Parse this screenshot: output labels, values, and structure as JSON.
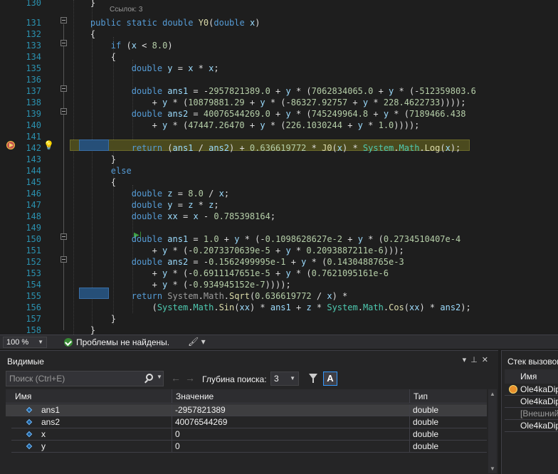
{
  "editor": {
    "codelens": "Ссылок: 3",
    "lines": [
      {
        "n": "130",
        "html": "    }"
      },
      {
        "n": "131",
        "html": "    <span class='kw'>public</span> <span class='kw'>static</span> <span class='kw'>double</span> <span class='mt'>Y0</span>(<span class='kw'>double</span> <span class='va'>x</span>)"
      },
      {
        "n": "132",
        "html": "    {"
      },
      {
        "n": "133",
        "html": "        <span class='kw'>if</span> (<span class='va'>x</span> &lt; <span class='nm'>8.0</span>)"
      },
      {
        "n": "134",
        "html": "        {"
      },
      {
        "n": "135",
        "html": "            <span class='kw'>double</span> <span class='va'>y</span> = <span class='va'>x</span> * <span class='va'>x</span>;"
      },
      {
        "n": "136",
        "html": ""
      },
      {
        "n": "137",
        "html": "            <span class='kw'>double</span> <span class='va'>ans1</span> = -<span class='nm'>2957821389.0</span> + <span class='va'>y</span> * (<span class='nm'>7062834065.0</span> + <span class='va'>y</span> * (-<span class='nm'>512359803.6</span>"
      },
      {
        "n": "138",
        "html": "                + <span class='va'>y</span> * (<span class='nm'>10879881.29</span> + <span class='va'>y</span> * (-<span class='nm'>86327.92757</span> + <span class='va'>y</span> * <span class='nm'>228.4622733</span>))));"
      },
      {
        "n": "139",
        "html": "            <span class='kw'>double</span> <span class='va'>ans2</span> = <span class='nm'>40076544269.0</span> + <span class='va'>y</span> * (<span class='nm'>745249964.8</span> + <span class='va'>y</span> * (<span class='nm'>7189466.438</span>"
      },
      {
        "n": "140",
        "html": "                + <span class='va'>y</span> * (<span class='nm'>47447.26470</span> + <span class='va'>y</span> * (<span class='nm'>226.1030244</span> + <span class='va'>y</span> * <span class='nm'>1.0</span>))));"
      },
      {
        "n": "141",
        "html": ""
      },
      {
        "n": "142",
        "html": "            <span class='kw'>return</span> (<span class='va'>ans1</span> / <span class='va'>ans2</span>) + <span class='nm'>0.636619772</span> * <span class='mt'>J0</span>(<span class='va'>x</span>) * <span class='ty'>System</span>.<span class='ty'>Math</span>.<span class='mt'>Log</span>(<span class='va'>x</span>);"
      },
      {
        "n": "143",
        "html": "        }"
      },
      {
        "n": "144",
        "html": "        <span class='kw'>else</span>"
      },
      {
        "n": "145",
        "html": "        {"
      },
      {
        "n": "146",
        "html": "            <span class='kw'>double</span> <span class='va'>z</span> = <span class='nm'>8.0</span> / <span class='va'>x</span>;"
      },
      {
        "n": "147",
        "html": "            <span class='kw'>double</span> <span class='va'>y</span> = <span class='va'>z</span> * <span class='va'>z</span>;"
      },
      {
        "n": "148",
        "html": "            <span class='kw'>double</span> <span class='va'>xx</span> = <span class='va'>x</span> - <span class='nm'>0.785398164</span>;"
      },
      {
        "n": "149",
        "html": ""
      },
      {
        "n": "150",
        "html": "            <span class='kw'>double</span> <span class='va'>ans1</span> = <span class='nm'>1.0</span> + <span class='va'>y</span> * (-<span class='nm'>0.1098628627e-2</span> + <span class='va'>y</span> * (<span class='nm'>0.2734510407e-4</span>"
      },
      {
        "n": "151",
        "html": "                + <span class='va'>y</span> * (-<span class='nm'>0.2073370639e-5</span> + <span class='va'>y</span> * <span class='nm'>0.2093887211e-6</span>)));"
      },
      {
        "n": "152",
        "html": "            <span class='kw'>double</span> <span class='va'>ans2</span> = -<span class='nm'>0.1562499995e-1</span> + <span class='va'>y</span> * (<span class='nm'>0.1430488765e-3</span>"
      },
      {
        "n": "153",
        "html": "                + <span class='va'>y</span> * (-<span class='nm'>0.6911147651e-5</span> + <span class='va'>y</span> * (<span class='nm'>0.7621095161e-6</span>"
      },
      {
        "n": "154",
        "html": "                + <span class='va'>y</span> * (-<span class='nm'>0.934945152e-7</span>))));"
      },
      {
        "n": "155",
        "html": "            <span class='kw'>return</span> <span class='dim'>System</span>.<span class='dim'>Math</span>.<span class='mt'>Sqrt</span>(<span class='nm'>0.636619772</span> / <span class='va'>x</span>) *"
      },
      {
        "n": "156",
        "html": "                (<span class='ty'>System</span>.<span class='ty'>Math</span>.<span class='mt'>Sin</span>(<span class='va'>xx</span>) * <span class='va'>ans1</span> + <span class='va'>z</span> * <span class='ty'>System</span>.<span class='ty'>Math</span>.<span class='mt'>Cos</span>(<span class='va'>xx</span>) * <span class='va'>ans2</span>);"
      },
      {
        "n": "157",
        "html": "        }"
      },
      {
        "n": "158",
        "html": "    }"
      }
    ]
  },
  "status": {
    "zoom": "100 %",
    "problems": "Проблемы не найдены."
  },
  "watch": {
    "title": "Видимые",
    "search_placeholder": "Поиск (Ctrl+E)",
    "depth_label": "Глубина поиска:",
    "depth_value": "3",
    "case_label": "A",
    "columns": {
      "name": "Имя",
      "value": "Значение",
      "type": "Тип"
    },
    "rows": [
      {
        "name": "ans1",
        "value": "-2957821389",
        "type": "double"
      },
      {
        "name": "ans2",
        "value": "40076544269",
        "type": "double"
      },
      {
        "name": "x",
        "value": "0",
        "type": "double"
      },
      {
        "name": "y",
        "value": "0",
        "type": "double"
      }
    ]
  },
  "callstack": {
    "title": "Стек вызовов",
    "column": "Имя",
    "rows": [
      {
        "label": "Ole4kaDip"
      },
      {
        "label": "Ole4kaDip"
      },
      {
        "label": "[Внешний"
      },
      {
        "label": "Ole4kaDip"
      }
    ]
  }
}
